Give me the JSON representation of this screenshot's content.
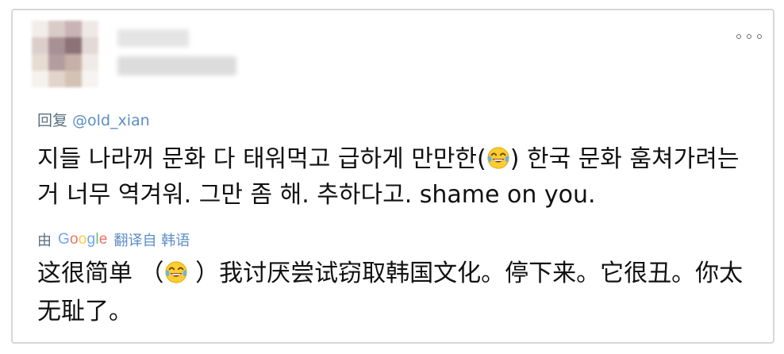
{
  "tweet": {
    "reply_prefix": "回复 ",
    "reply_to": "@old_xian",
    "text_part1": "지들 나라꺼 문화 다 태워먹고 급하게 만만한(",
    "text_part2": ") 한국 문화 훔쳐가려는거 너무 역겨워. 그만 좀 해. 추하다고. shame on you.",
    "emoji_name": "face-with-tears-of-joy-icon"
  },
  "translation": {
    "by_label": "由",
    "provider_letters": [
      "G",
      "o",
      "o",
      "g",
      "l",
      "e"
    ],
    "provider_colors": [
      "#4285f4",
      "#ea4335",
      "#fbbc05",
      "#4285f4",
      "#34a853",
      "#ea4335"
    ],
    "link_label": "翻译自 韩语",
    "text_part1": "这很简单 （",
    "text_part2": " ）我讨厌尝试窃取韩国文化。停下来。它很丑。你太无耻了。"
  },
  "colors": {
    "link": "#5b8ec4",
    "secondary_text": "#5b7083",
    "border": "#d7d7d7"
  }
}
